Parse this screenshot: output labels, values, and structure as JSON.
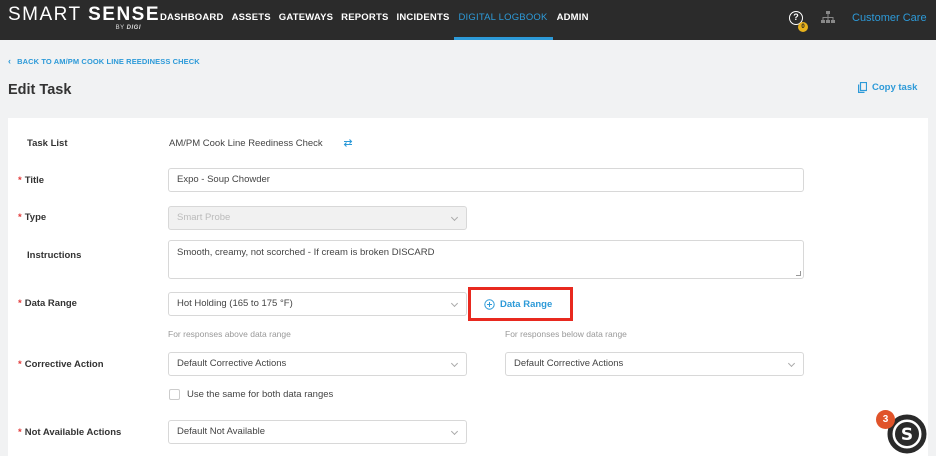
{
  "brand": {
    "name_light": "SMART",
    "name_bold": "SENSE",
    "by": "BY",
    "by_brand": "DIGI"
  },
  "nav": {
    "items": [
      {
        "label": "DASHBOARD",
        "active": false
      },
      {
        "label": "ASSETS",
        "active": false
      },
      {
        "label": "GATEWAYS",
        "active": false
      },
      {
        "label": "REPORTS",
        "active": false
      },
      {
        "label": "INCIDENTS",
        "active": false
      },
      {
        "label": "DIGITAL LOGBOOK",
        "active": true
      },
      {
        "label": "ADMIN",
        "active": false
      }
    ],
    "help_icon": "question-circle-icon",
    "help_badge": "0",
    "org_icon": "org-chart-icon",
    "customer_care": "Customer Care"
  },
  "breadcrumb": {
    "back_label": "BACK TO AM/PM COOK LINE REEDINESS CHECK",
    "icon": "chevron-left-icon"
  },
  "page": {
    "title": "Edit Task",
    "copy_label": "Copy task",
    "copy_icon": "copy-icon"
  },
  "form": {
    "task_list": {
      "label": "Task List",
      "value": "AM/PM Cook Line Reediness Check",
      "icon": "swap-arrows-icon"
    },
    "title": {
      "label": "Title",
      "value": "Expo - Soup Chowder"
    },
    "type": {
      "label": "Type",
      "value": "Smart Probe"
    },
    "instructions": {
      "label": "Instructions",
      "value": "Smooth, creamy, not scorched - If cream is broken DISCARD"
    },
    "data_range": {
      "label": "Data Range",
      "value": "Hot Holding (165 to 175 °F)",
      "add_label": "Data Range",
      "add_icon": "plus-circle-icon"
    },
    "hints": {
      "above": "For responses above data range",
      "below": "For responses below data range"
    },
    "corrective_action": {
      "label": "Corrective Action",
      "above_value": "Default Corrective Actions",
      "below_value": "Default Corrective Actions"
    },
    "same_for_both": {
      "label": "Use the same for both data ranges",
      "checked": false
    },
    "not_available": {
      "label": "Not Available Actions",
      "value": "Default Not Available"
    }
  },
  "chat": {
    "badge": "3",
    "letter": "S"
  },
  "colors": {
    "accent": "#2d9ad8",
    "topbar": "#2b2b2b",
    "required": "#e23b3b",
    "highlight": "#e8291f",
    "badge": "#e8b21c"
  }
}
